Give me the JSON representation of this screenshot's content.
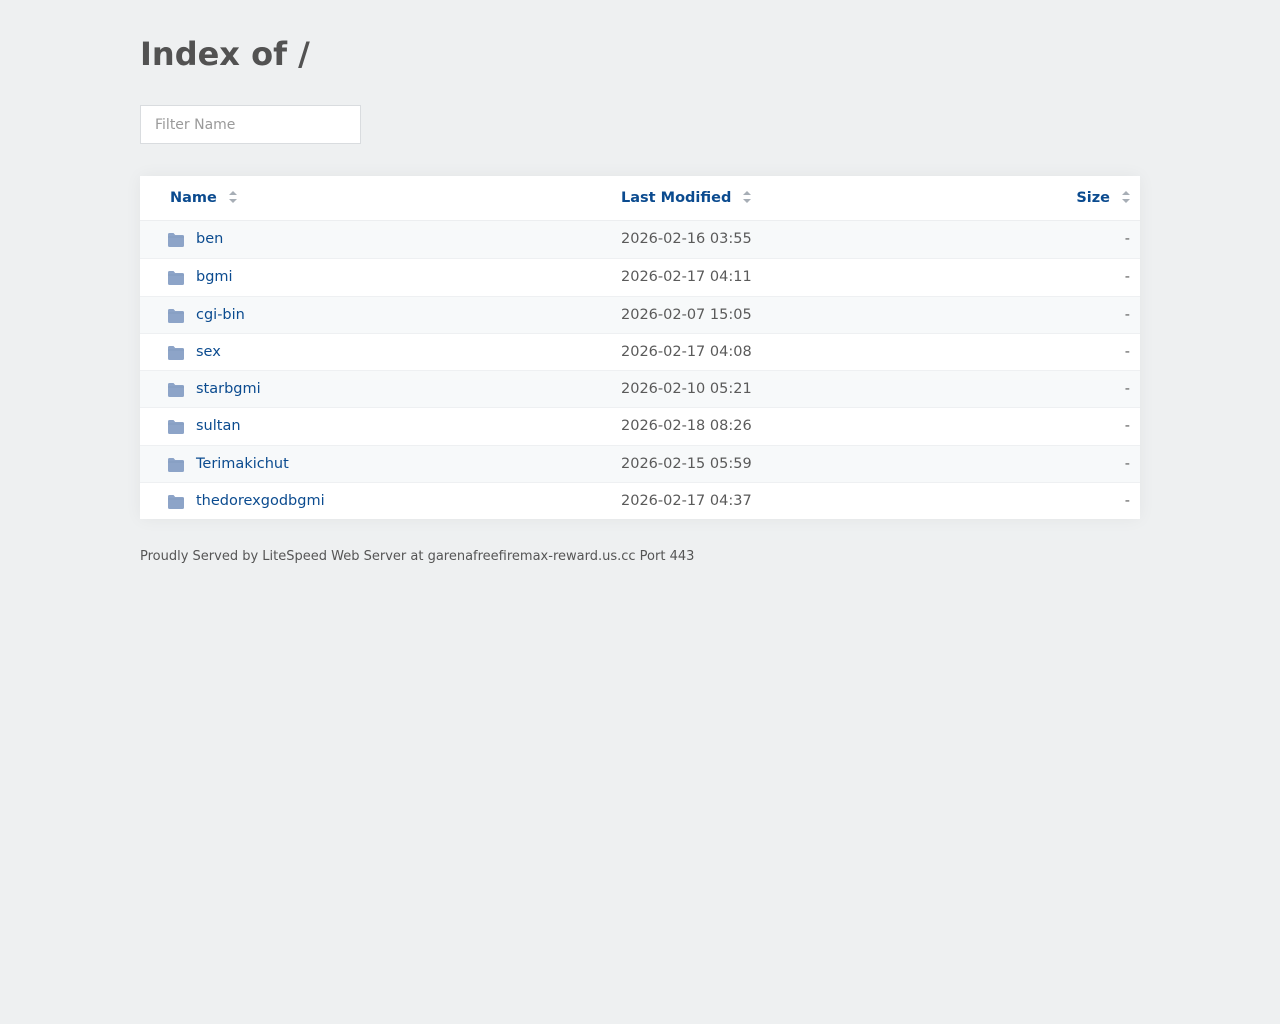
{
  "page": {
    "title": "Index of /"
  },
  "filter": {
    "placeholder": "Filter Name",
    "value": ""
  },
  "table": {
    "headers": {
      "name": "Name",
      "last_modified": "Last Modified",
      "size": "Size"
    },
    "rows": [
      {
        "name": "ben",
        "modified": "2026-02-16 03:55",
        "size": "-"
      },
      {
        "name": "bgmi",
        "modified": "2026-02-17 04:11",
        "size": "-"
      },
      {
        "name": "cgi-bin",
        "modified": "2026-02-07 15:05",
        "size": "-"
      },
      {
        "name": "sex",
        "modified": "2026-02-17 04:08",
        "size": "-"
      },
      {
        "name": "starbgmi",
        "modified": "2026-02-10 05:21",
        "size": "-"
      },
      {
        "name": "sultan",
        "modified": "2026-02-18 08:26",
        "size": "-"
      },
      {
        "name": "Terimakichut",
        "modified": "2026-02-15 05:59",
        "size": "-"
      },
      {
        "name": "thedorexgodbgmi",
        "modified": "2026-02-17 04:37",
        "size": "-"
      }
    ]
  },
  "footer": {
    "text": "Proudly Served by LiteSpeed Web Server at garenafreefiremax-reward.us.cc Port 443"
  },
  "colors": {
    "background": "#eef0f1",
    "link": "#0b4b8f",
    "folder_icon": "#8da4c8"
  },
  "icons": {
    "row": "folder-icon",
    "sort": "sort-icon"
  }
}
